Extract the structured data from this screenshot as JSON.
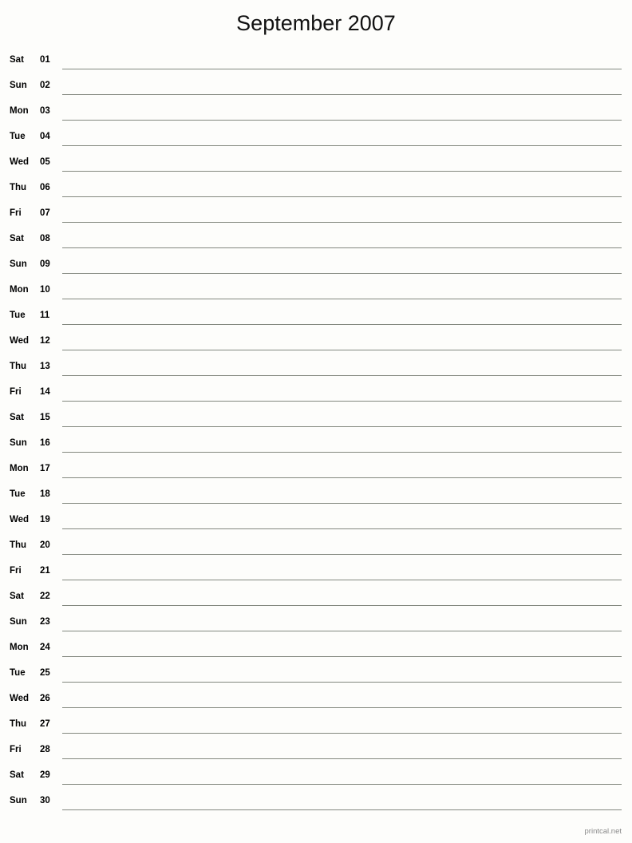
{
  "document": {
    "title": "September 2007",
    "type": "printable-monthly-calendar",
    "background_color": "#fdfdfb",
    "rule_color": "#83887f",
    "text_color": "#000000"
  },
  "footer": {
    "credit": "printcal.net",
    "color": "#8a8a8a"
  },
  "days": [
    {
      "weekday": "Sat",
      "number": "01"
    },
    {
      "weekday": "Sun",
      "number": "02"
    },
    {
      "weekday": "Mon",
      "number": "03"
    },
    {
      "weekday": "Tue",
      "number": "04"
    },
    {
      "weekday": "Wed",
      "number": "05"
    },
    {
      "weekday": "Thu",
      "number": "06"
    },
    {
      "weekday": "Fri",
      "number": "07"
    },
    {
      "weekday": "Sat",
      "number": "08"
    },
    {
      "weekday": "Sun",
      "number": "09"
    },
    {
      "weekday": "Mon",
      "number": "10"
    },
    {
      "weekday": "Tue",
      "number": "11"
    },
    {
      "weekday": "Wed",
      "number": "12"
    },
    {
      "weekday": "Thu",
      "number": "13"
    },
    {
      "weekday": "Fri",
      "number": "14"
    },
    {
      "weekday": "Sat",
      "number": "15"
    },
    {
      "weekday": "Sun",
      "number": "16"
    },
    {
      "weekday": "Mon",
      "number": "17"
    },
    {
      "weekday": "Tue",
      "number": "18"
    },
    {
      "weekday": "Wed",
      "number": "19"
    },
    {
      "weekday": "Thu",
      "number": "20"
    },
    {
      "weekday": "Fri",
      "number": "21"
    },
    {
      "weekday": "Sat",
      "number": "22"
    },
    {
      "weekday": "Sun",
      "number": "23"
    },
    {
      "weekday": "Mon",
      "number": "24"
    },
    {
      "weekday": "Tue",
      "number": "25"
    },
    {
      "weekday": "Wed",
      "number": "26"
    },
    {
      "weekday": "Thu",
      "number": "27"
    },
    {
      "weekday": "Fri",
      "number": "28"
    },
    {
      "weekday": "Sat",
      "number": "29"
    },
    {
      "weekday": "Sun",
      "number": "30"
    }
  ]
}
